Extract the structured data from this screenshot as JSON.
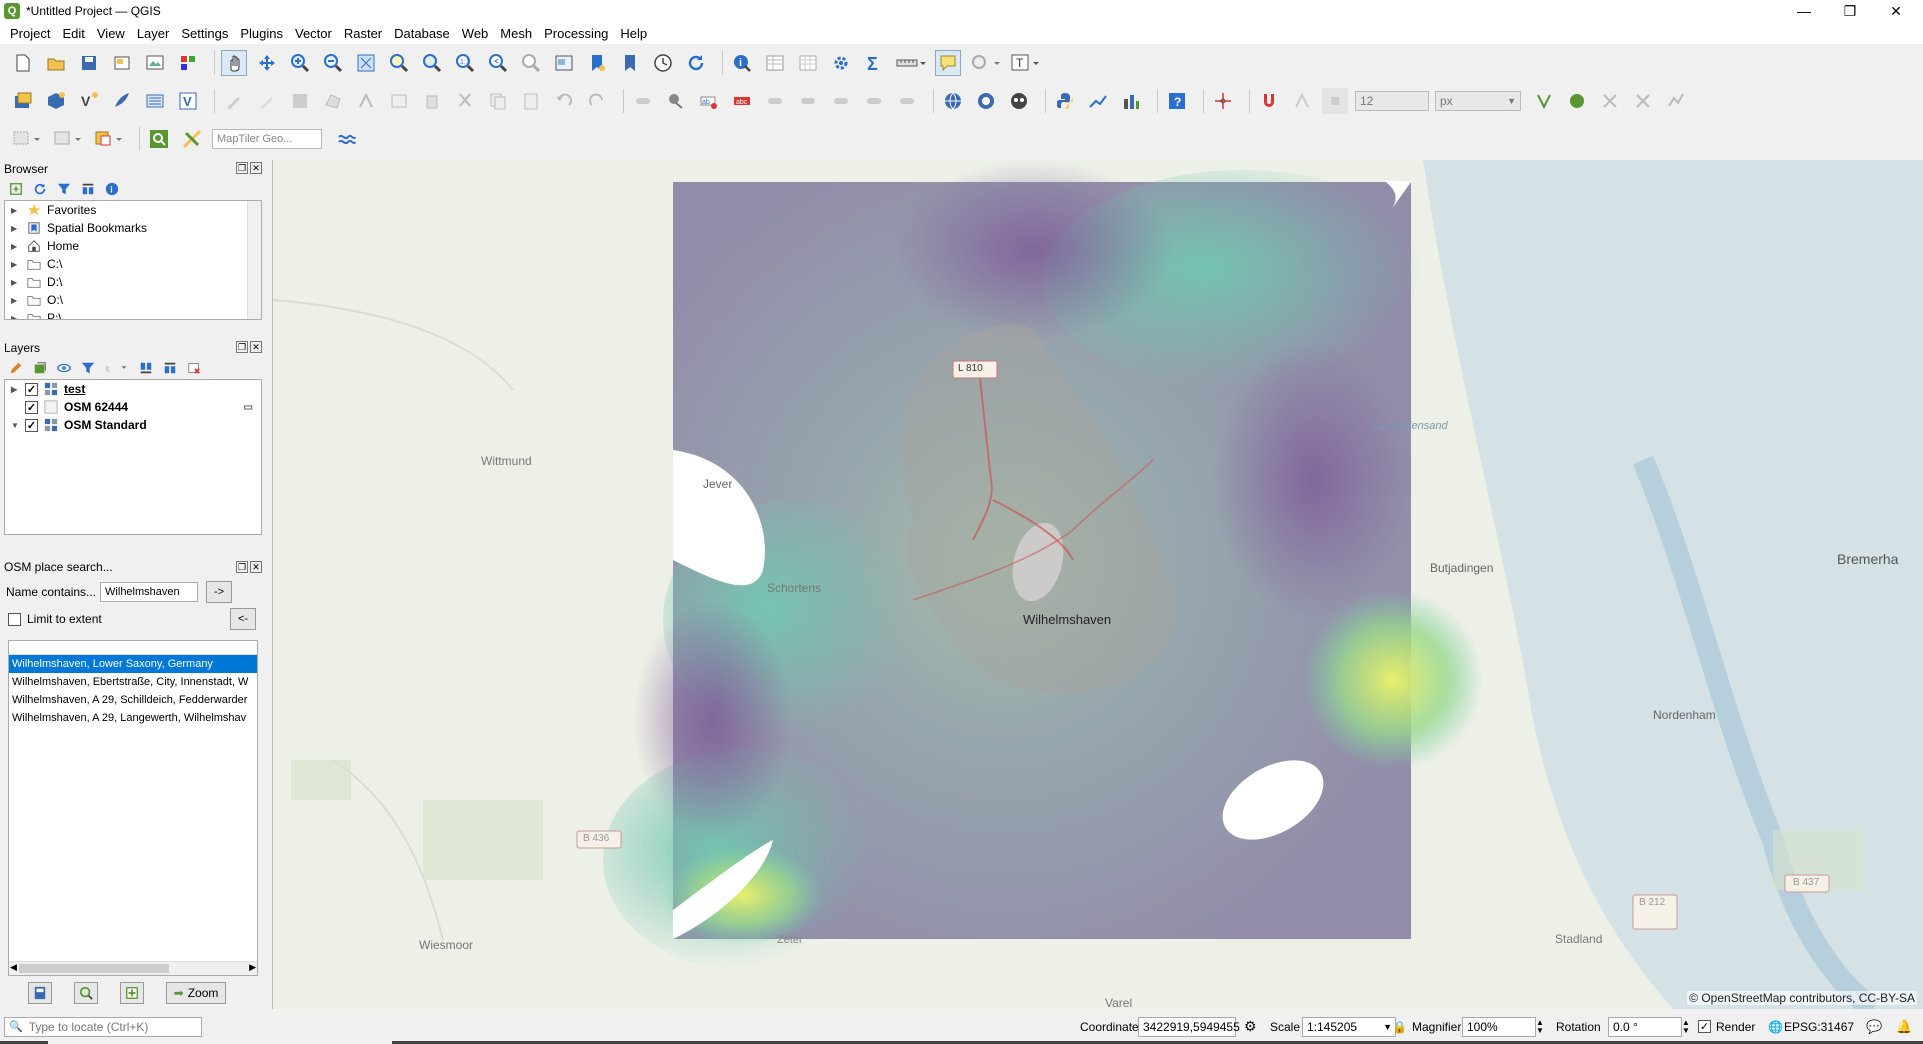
{
  "window": {
    "title": "*Untitled Project — QGIS",
    "app_icon": "Q"
  },
  "menu": [
    "Project",
    "Edit",
    "View",
    "Layer",
    "Settings",
    "Plugins",
    "Vector",
    "Raster",
    "Database",
    "Web",
    "Mesh",
    "Processing",
    "Help"
  ],
  "toolbar": {
    "snap_tolerance": "12",
    "snap_unit": "px",
    "geocoder_placeholder": "MapTiler Geo..."
  },
  "browser": {
    "title": "Browser",
    "items": [
      {
        "label": "Favorites",
        "icon": "star-icon"
      },
      {
        "label": "Spatial Bookmarks",
        "icon": "bookmark-icon"
      },
      {
        "label": "Home",
        "icon": "home-icon"
      },
      {
        "label": "C:\\",
        "icon": "folder-icon"
      },
      {
        "label": "D:\\",
        "icon": "folder-icon"
      },
      {
        "label": "O:\\",
        "icon": "folder-icon"
      },
      {
        "label": "P:\\",
        "icon": "folder-icon"
      }
    ]
  },
  "layers": {
    "title": "Layers",
    "items": [
      {
        "label": "test",
        "checked": true,
        "underline": true
      },
      {
        "label": "OSM 62444",
        "checked": true,
        "underline": false
      },
      {
        "label": "OSM Standard",
        "checked": true,
        "underline": false
      }
    ]
  },
  "osm_search": {
    "title": "OSM place search...",
    "name_label": "Name contains...",
    "name_value": "Wilhelmshaven",
    "go_button": "->",
    "limit_label": "Limit to extent",
    "back_button": "<-",
    "results": [
      "Wilhelmshaven, Lower Saxony, Germany",
      "Wilhelmshaven, Ebertstraße, City, Innenstadt, W",
      "Wilhelmshaven, A 29, Schilldeich, Fedderwarder",
      "Wilhelmshaven, A 29, Langewerth, Wilhelmshav"
    ],
    "zoom_button": "Zoom"
  },
  "map": {
    "attribution": "© OpenStreetMap contributors, CC-BY-SA",
    "labels": [
      {
        "text": "Wilhelmshaven"
      },
      {
        "text": "Wittmund"
      },
      {
        "text": "Jever"
      },
      {
        "text": "Schortens"
      },
      {
        "text": "Butjadingen"
      },
      {
        "text": "Bremerha"
      },
      {
        "text": "Nordenham"
      },
      {
        "text": "Stadland"
      },
      {
        "text": "Wiesmoor"
      },
      {
        "text": "Zetel"
      },
      {
        "text": "Varel"
      },
      {
        "text": "L 810"
      },
      {
        "text": "B 436"
      },
      {
        "text": "B 437"
      },
      {
        "text": "B 212"
      },
      {
        "text": "Langlütjensand"
      }
    ]
  },
  "status": {
    "locate_placeholder": "Type to locate (Ctrl+K)",
    "coordinate_label": "Coordinate",
    "coordinate_value": "3422919,5949455",
    "scale_label": "Scale",
    "scale_value": "1:145205",
    "magnifier_label": "Magnifier",
    "magnifier_value": "100%",
    "rotation_label": "Rotation",
    "rotation_value": "0.0 °",
    "render_label": "Render",
    "crs": "EPSG:31467"
  },
  "colors": {
    "accent": "#0078d7",
    "qgis_green": "#589632",
    "selection": "#0078d7"
  }
}
